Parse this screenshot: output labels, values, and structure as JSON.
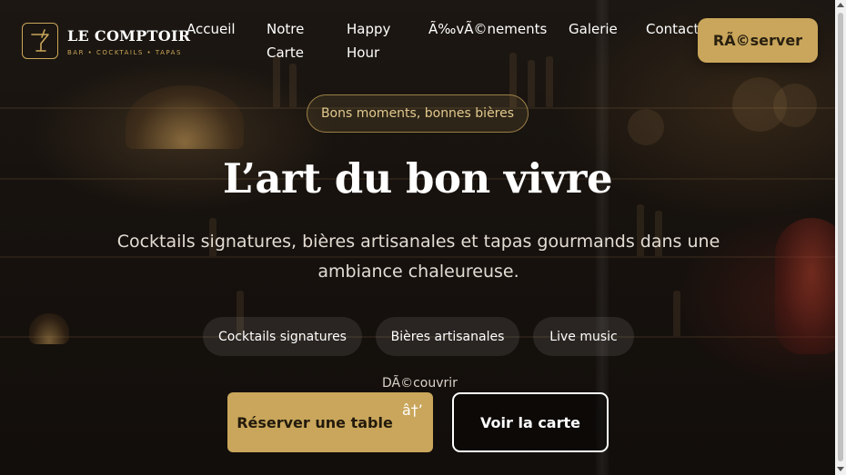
{
  "brand": {
    "name": "LE COMPTOIR",
    "tagline": "BAR • COCKTAILS • TAPAS",
    "accent_color": "#c9a65b",
    "logo_icon": "cocktail-glass-icon"
  },
  "nav": {
    "items": [
      {
        "label": "Accueil"
      },
      {
        "label": "Notre Carte"
      },
      {
        "label": "Happy Hour"
      },
      {
        "label": "Ã‰vÃ©nements"
      },
      {
        "label": "Galerie"
      },
      {
        "label": "Contact"
      }
    ],
    "cta_label": "RÃ©server"
  },
  "hero": {
    "tag": "Bons moments, bonnes bières",
    "title": "L’art du bon vivre",
    "subtitle": "Cocktails signatures, bières artisanales et tapas gourmands dans une ambiance chaleureuse.",
    "features": [
      "Cocktails signatures",
      "Bières artisanales",
      "Live music"
    ],
    "discover_label": "DÃ©couvrir",
    "primary_button": "Réserver une table",
    "primary_button_arrow": "â†’",
    "secondary_button": "Voir la carte"
  }
}
